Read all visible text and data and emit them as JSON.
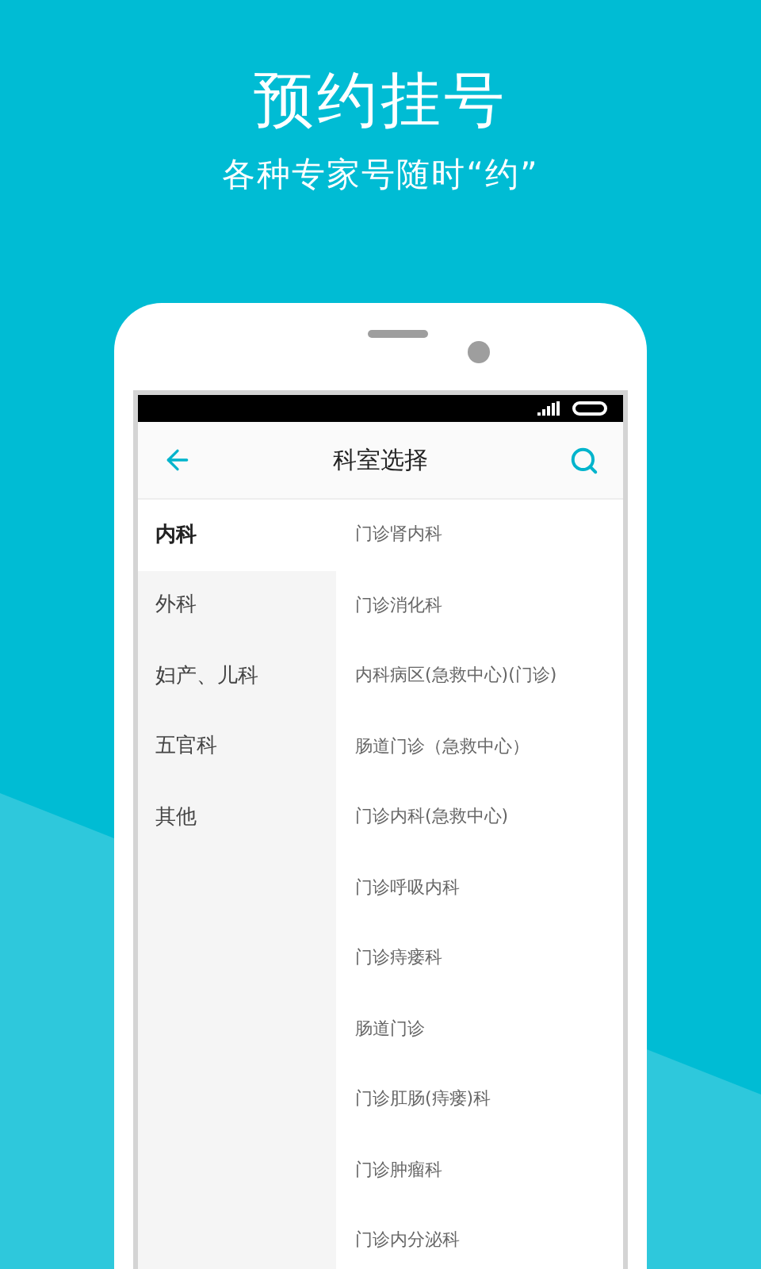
{
  "promo": {
    "title": "预约挂号",
    "subtitle": "各种专家号随时“约”"
  },
  "header": {
    "title": "科室选择"
  },
  "categories": [
    {
      "label": "内科",
      "selected": true
    },
    {
      "label": "外科",
      "selected": false
    },
    {
      "label": "妇产、儿科",
      "selected": false
    },
    {
      "label": "五官科",
      "selected": false
    },
    {
      "label": "其他",
      "selected": false
    }
  ],
  "departments": [
    "门诊肾内科",
    "门诊消化科",
    "内科病区(急救中心)(门诊)",
    "肠道门诊（急救中心）",
    "门诊内科(急救中心)",
    "门诊呼吸内科",
    "门诊痔瘘科",
    "肠道门诊",
    "门诊肛肠(痔瘘)科",
    "门诊肿瘤科",
    "门诊内分泌科"
  ]
}
